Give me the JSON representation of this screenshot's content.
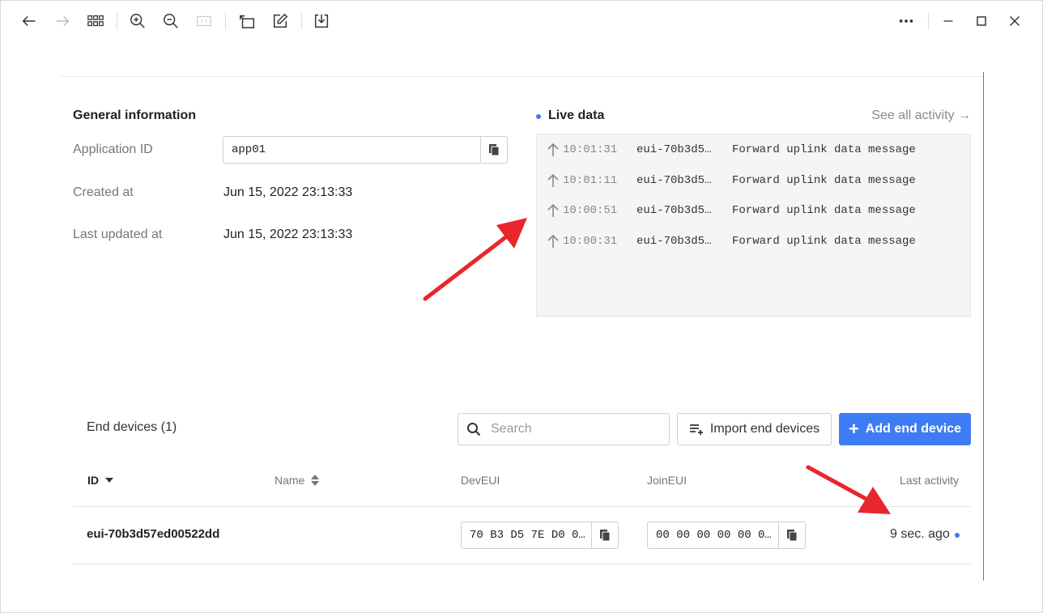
{
  "toolbar": {
    "icons": [
      "back-icon",
      "forward-icon",
      "grid-icon",
      "zoom-in-icon",
      "zoom-out-icon",
      "fit-icon",
      "rotate-icon",
      "edit-icon",
      "download-icon",
      "more-icon",
      "minimize-icon",
      "maximize-icon",
      "close-icon"
    ]
  },
  "general": {
    "title": "General information",
    "app_id_label": "Application ID",
    "app_id_value": "app01",
    "created_label": "Created at",
    "created_value": "Jun 15, 2022 23:13:33",
    "updated_label": "Last updated at",
    "updated_value": "Jun 15, 2022 23:13:33"
  },
  "live": {
    "title": "Live data",
    "see_all": "See all activity →",
    "rows": [
      {
        "time": "10:01:31",
        "device": "eui-70b3d5…",
        "message": "Forward uplink data message"
      },
      {
        "time": "10:01:11",
        "device": "eui-70b3d5…",
        "message": "Forward uplink data message"
      },
      {
        "time": "10:00:51",
        "device": "eui-70b3d5…",
        "message": "Forward uplink data message"
      },
      {
        "time": "10:00:31",
        "device": "eui-70b3d5…",
        "message": "Forward uplink data message"
      }
    ]
  },
  "end_devices": {
    "title": "End devices (1)",
    "search_placeholder": "Search",
    "import_label": "Import end devices",
    "add_label": "Add end device",
    "columns": {
      "id": "ID",
      "name": "Name",
      "deveui": "DevEUI",
      "joineui": "JoinEUI",
      "last_activity": "Last activity"
    },
    "rows": [
      {
        "id": "eui-70b3d57ed00522dd",
        "name": "",
        "deveui": "70 B3 D5 7E D0 0…",
        "joineui": "00 00 00 00 00 0…",
        "last_activity": "9 sec. ago"
      }
    ]
  },
  "colors": {
    "accent": "#3d7cf5",
    "annotation": "#e8262c"
  }
}
